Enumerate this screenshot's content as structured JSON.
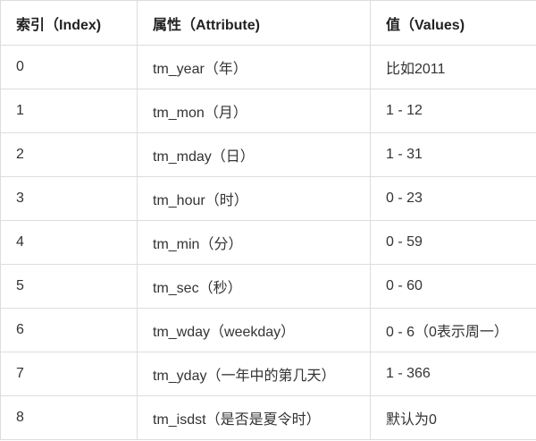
{
  "headers": [
    "索引（Index)",
    "属性（Attribute)",
    "值（Values)"
  ],
  "rows": [
    [
      "0",
      "tm_year（年）",
      "比如2011"
    ],
    [
      "1",
      "tm_mon（月）",
      "1 - 12"
    ],
    [
      "2",
      "tm_mday（日）",
      "1 - 31"
    ],
    [
      "3",
      "tm_hour（时）",
      "0 - 23"
    ],
    [
      "4",
      "tm_min（分）",
      "0 - 59"
    ],
    [
      "5",
      "tm_sec（秒）",
      "0 - 60"
    ],
    [
      "6",
      "tm_wday（weekday）",
      "0 - 6（0表示周一）"
    ],
    [
      "7",
      "tm_yday（一年中的第几天）",
      "1 - 366"
    ],
    [
      "8",
      "tm_isdst（是否是夏令时）",
      "默认为0"
    ]
  ]
}
